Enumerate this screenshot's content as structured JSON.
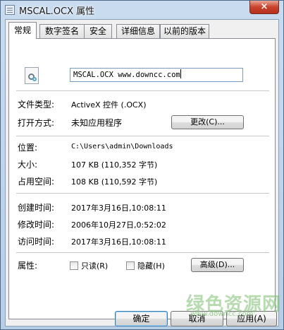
{
  "window": {
    "title": "MSCAL.OCX 属性",
    "close_symbol": "×"
  },
  "tabs": [
    {
      "label": "常规",
      "active": true
    },
    {
      "label": "数字签名"
    },
    {
      "label": "安全"
    },
    {
      "label": "详细信息"
    },
    {
      "label": "以前的版本"
    }
  ],
  "general": {
    "file_name": "MSCAL.OCX www.downcc.com",
    "file_type_label": "文件类型:",
    "file_type_value": "ActiveX 控件 (.OCX)",
    "opens_with_label": "打开方式:",
    "opens_with_value": "未知应用程序",
    "change_button": "更改(C)...",
    "location_label": "位置:",
    "location_value": "C:\\Users\\admin\\Downloads",
    "size_label": "大小:",
    "size_value": "107 KB (110,352 字节)",
    "size_on_disk_label": "占用空间:",
    "size_on_disk_value": "108 KB (110,592 字节)",
    "created_label": "创建时间:",
    "created_value": "2017年3月16日,10:08:11",
    "modified_label": "修改时间:",
    "modified_value": "2006年10月27日,0:52:02",
    "accessed_label": "访问时间:",
    "accessed_value": "2017年3月16日,10:08:11",
    "attributes_label": "属性:",
    "readonly_label": "只读(R)",
    "readonly_checked": false,
    "hidden_label": "隐藏(H)",
    "hidden_checked": false,
    "advanced_button": "高级(D)..."
  },
  "footer": {
    "ok_button": "确定",
    "cancel_button": "取消",
    "apply_button": "应用(A)"
  },
  "watermark": {
    "text": "绿色资源网",
    "sub": "www.downcc.com"
  }
}
